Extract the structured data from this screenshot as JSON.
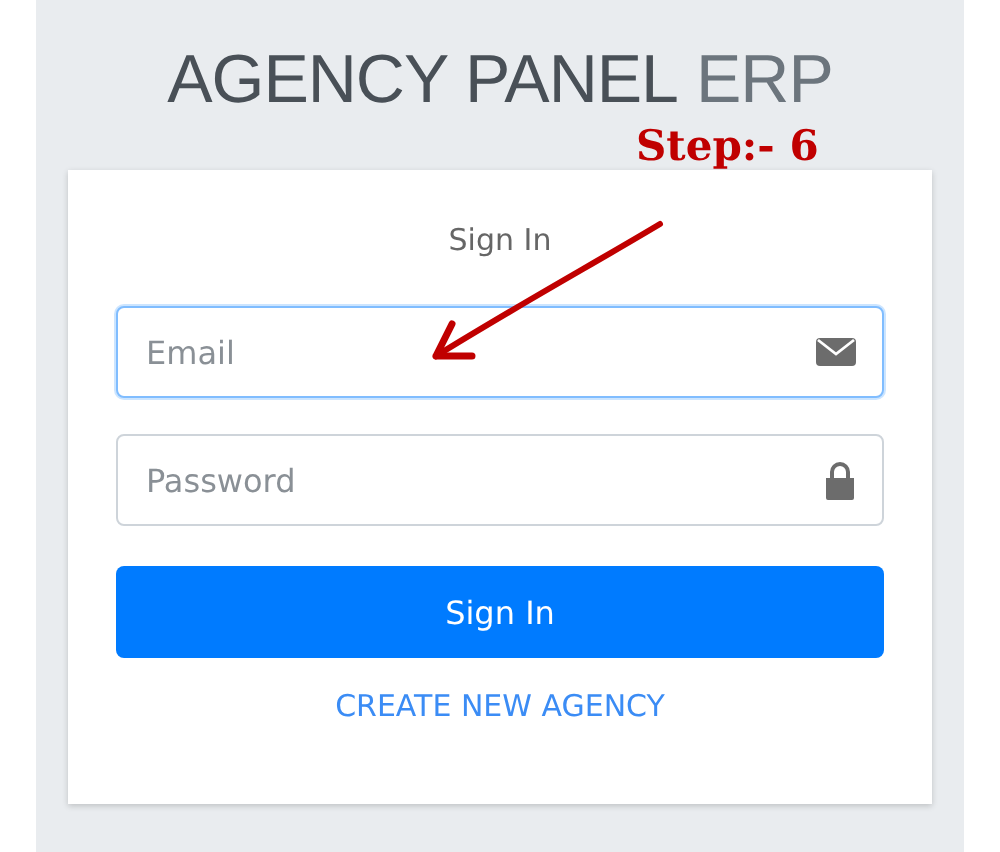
{
  "brand": {
    "main": "AGENCY PANEL",
    "suffix": "ERP"
  },
  "annotation": {
    "label": "Step:- 6"
  },
  "card": {
    "title": "Sign In",
    "fields": [
      {
        "kind": "email",
        "placeholder": "Email",
        "focused": true
      },
      {
        "kind": "password",
        "placeholder": "Password",
        "focused": false
      }
    ],
    "submit": "Sign In",
    "link": "CREATE NEW AGENCY"
  }
}
